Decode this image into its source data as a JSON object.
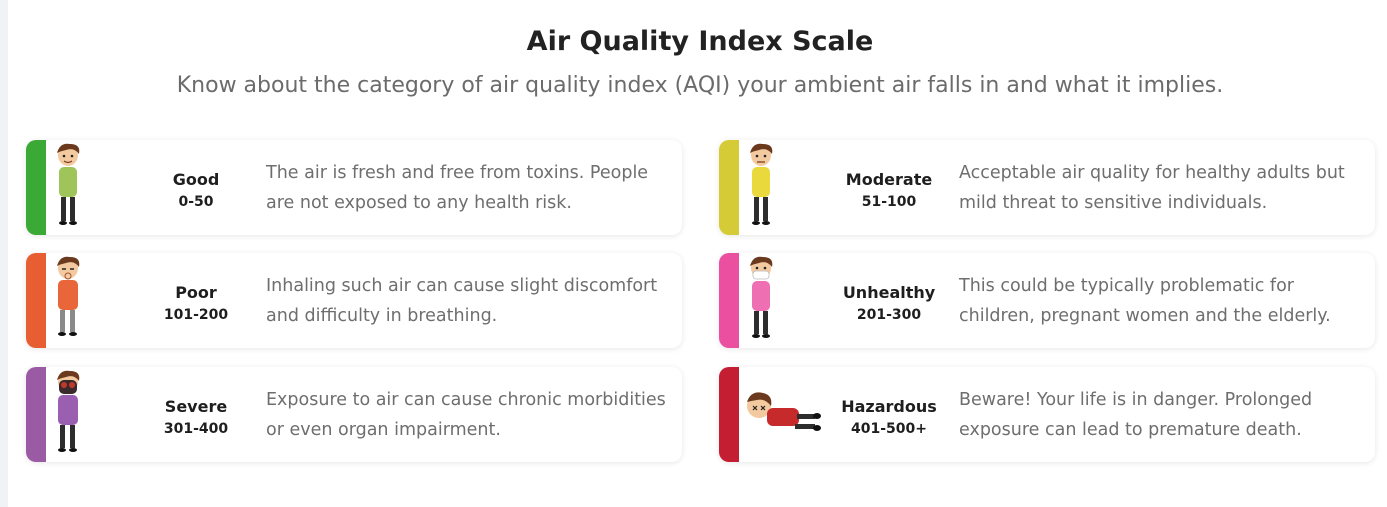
{
  "header": {
    "title": "Air Quality Index Scale",
    "subtitle": "Know about the category of air quality index (AQI) your ambient air falls in and what it implies."
  },
  "categories": [
    {
      "name": "Good",
      "range": "0-50",
      "color": "#3aa935",
      "icon": "healthy-boy-icon",
      "description": "The air is fresh and free from toxins. People are not exposed to any health risk."
    },
    {
      "name": "Moderate",
      "range": "51-100",
      "color": "#d4cb36",
      "icon": "mildly-affected-boy-icon",
      "description": "Acceptable air quality for healthy adults but mild threat to sensitive individuals."
    },
    {
      "name": "Poor",
      "range": "101-200",
      "color": "#e85e33",
      "icon": "coughing-boy-icon",
      "description": "Inhaling such air can cause slight discomfort and difficulty in breathing."
    },
    {
      "name": "Unhealthy",
      "range": "201-300",
      "color": "#ea4fa0",
      "icon": "masked-boy-icon",
      "description": "This could be typically problematic for children, pregnant women and the elderly."
    },
    {
      "name": "Severe",
      "range": "301-400",
      "color": "#9b5aa4",
      "icon": "gas-mask-boy-icon",
      "description": "Exposure to air can cause chronic morbidities or even organ impairment."
    },
    {
      "name": "Hazardous",
      "range": "401-500+",
      "color": "#c41e33",
      "icon": "collapsed-boy-icon",
      "description": "Beware! Your life is in danger. Prolonged exposure can lead to premature death."
    }
  ]
}
